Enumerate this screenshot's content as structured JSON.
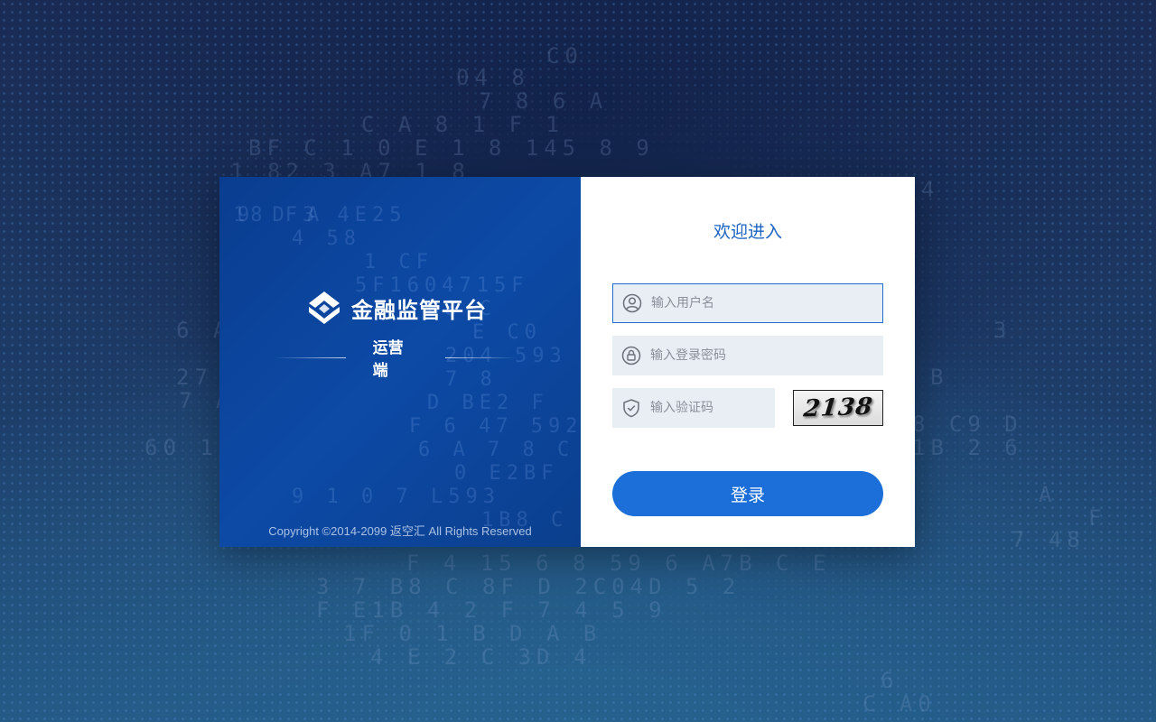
{
  "brand": {
    "name": "金融监管平台",
    "subtitle": "运营端",
    "copyright": "Copyright ©2014-2099 返空汇 All Rights Reserved"
  },
  "form": {
    "welcome": "欢迎进入",
    "username_placeholder": "输入用户名",
    "password_placeholder": "输入登录密码",
    "captcha_placeholder": "输入验证码",
    "captcha_text": "2138",
    "login_label": "登录"
  },
  "icons": {
    "logo": "diamond-logo-icon",
    "user": "user-icon",
    "password": "lock-icon",
    "captcha": "shield-check-icon"
  },
  "colors": {
    "accent": "#1c6fd8",
    "panel": "#0c4aa6",
    "field_bg": "#e9edf4",
    "title": "#1e64c2"
  }
}
